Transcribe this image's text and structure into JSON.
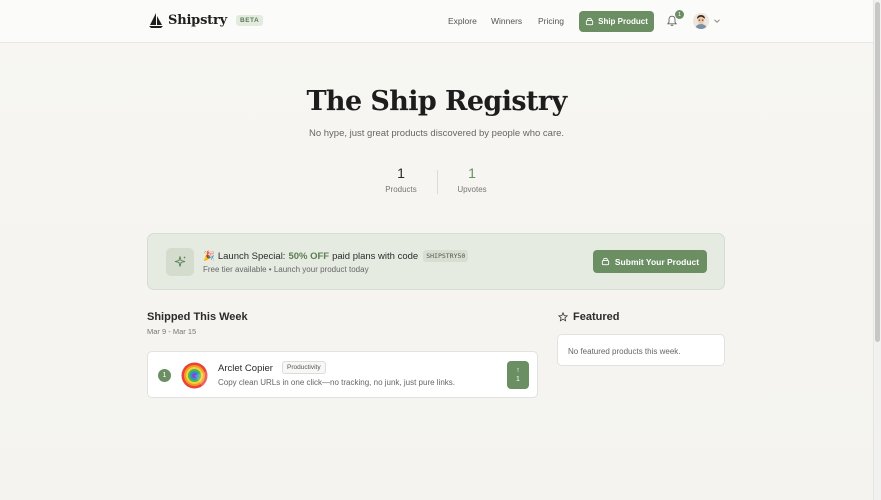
{
  "header": {
    "brand": "Shipstry",
    "badge": "BETA",
    "nav": {
      "explore": "Explore",
      "winners": "Winners",
      "pricing": "Pricing"
    },
    "ship_button": "Ship Product",
    "notification_count": "1"
  },
  "hero": {
    "title": "The Ship Registry",
    "subtitle": "No hype, just great products discovered by people who care.",
    "stats": {
      "products_value": "1",
      "products_label": "Products",
      "upvotes_value": "1",
      "upvotes_label": "Upvotes"
    }
  },
  "promo": {
    "emoji": "🎉",
    "prefix": "Launch Special:",
    "highlight": "50% OFF",
    "suffix": "paid plans with code",
    "code": "SHIPSTRY50",
    "subline": "Free tier available • Launch your product today",
    "submit_button": "Submit Your Product"
  },
  "shipped": {
    "title": "Shipped This Week",
    "dates": "Mar 9 - Mar 15",
    "products": [
      {
        "rank": "1",
        "name": "Arclet Copier",
        "tag": "Productivity",
        "description": "Copy clean URLs in one click—no tracking, no junk, just pure links.",
        "upvote_arrow": "↑",
        "upvotes": "1"
      }
    ]
  },
  "featured": {
    "title": "Featured",
    "empty_text": "No featured products this week."
  },
  "colors": {
    "accent": "#6b8f63",
    "background": "#f6f5f2"
  }
}
